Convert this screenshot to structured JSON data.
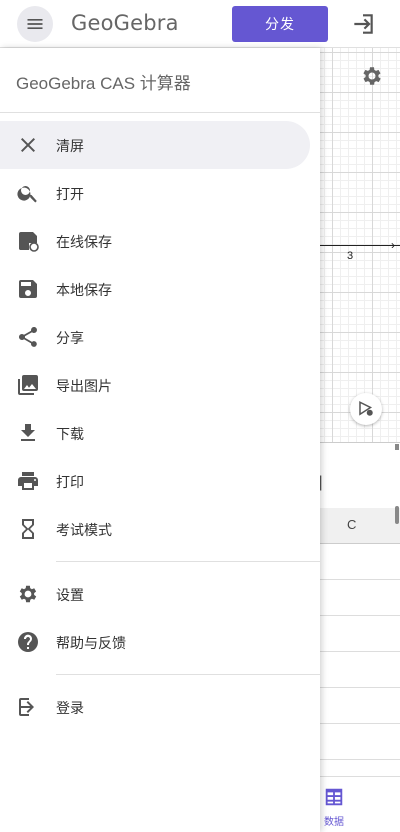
{
  "header": {
    "logo_text": "GeoGebra",
    "share_label": "分发",
    "menu_icon": "hamburger-icon",
    "signin_icon": "login-icon"
  },
  "graphics": {
    "tick_label": "3",
    "settings_icon": "gear-icon",
    "style_icon": "style-bar-icon"
  },
  "spreadsheet": {
    "column_label": "C"
  },
  "bottom_nav": {
    "data_label": "数据",
    "data_icon": "table-icon"
  },
  "drawer": {
    "title": "GeoGebra CAS 计算器",
    "items": [
      {
        "label": "清屏",
        "icon": "close-icon"
      },
      {
        "label": "打开",
        "icon": "search-icon"
      },
      {
        "label": "在线保存",
        "icon": "cloud-save-icon"
      },
      {
        "label": "本地保存",
        "icon": "save-icon"
      },
      {
        "label": "分享",
        "icon": "share-icon"
      },
      {
        "label": "导出图片",
        "icon": "image-icon"
      },
      {
        "label": "下载",
        "icon": "download-icon"
      },
      {
        "label": "打印",
        "icon": "print-icon"
      },
      {
        "label": "考试模式",
        "icon": "hourglass-icon"
      },
      {
        "label": "设置",
        "icon": "gear-icon"
      },
      {
        "label": "帮助与反馈",
        "icon": "help-icon"
      },
      {
        "label": "登录",
        "icon": "login-icon"
      }
    ]
  },
  "colors": {
    "accent": "#6557d2",
    "selected_bg": "#f0f0f4",
    "icon": "#555555"
  }
}
